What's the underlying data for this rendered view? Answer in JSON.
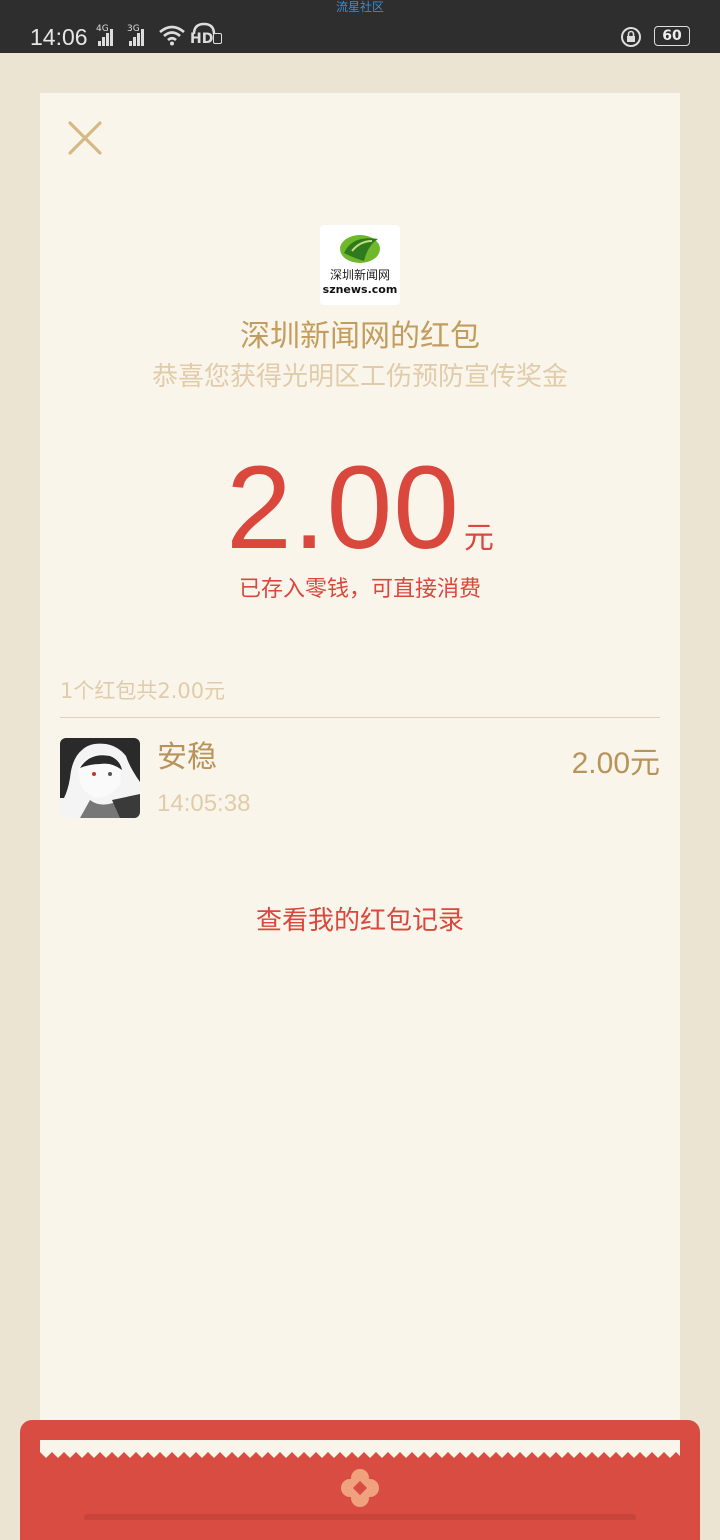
{
  "status_bar": {
    "top_label": "流星社区",
    "time": "14:06",
    "signal1_label": "4G",
    "signal2_label": "3G",
    "hd_label": "HD",
    "battery": "60"
  },
  "card": {
    "logo_text": "深圳新闻网",
    "logo_domain": "sznews.com",
    "sender_title": "深圳新闻网的红包",
    "sender_message": "恭喜您获得光明区工伤预防宣传奖金",
    "amount": "2.00",
    "amount_unit": "元",
    "amount_note": "已存入零钱，可直接消费",
    "summary": "1个红包共2.00元",
    "records": [
      {
        "name": "安稳",
        "time": "14:05:38",
        "amount": "2.00元"
      }
    ],
    "view_records_label": "查看我的红包记录"
  },
  "colors": {
    "accent_red": "#d9473d",
    "gold": "#c29d5e",
    "light_gold": "#e0ccaa",
    "card_bg": "#faf5ea",
    "page_bg": "#ece4d3"
  },
  "icons": [
    "close-icon",
    "signal-icon",
    "wifi-icon",
    "hd-call-icon",
    "rotation-lock-icon",
    "battery-icon",
    "emblem-icon",
    "logo-leaf-icon"
  ]
}
